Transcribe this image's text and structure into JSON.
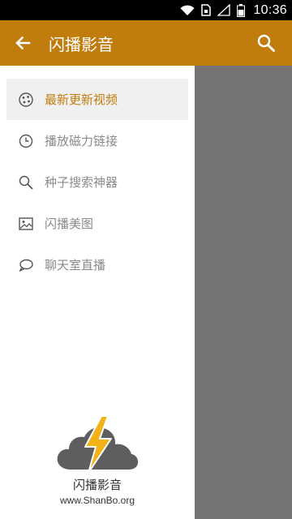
{
  "status_bar": {
    "time": "10:36",
    "icons": [
      "wifi-icon",
      "sim-card-icon",
      "signal-icon",
      "battery-icon"
    ]
  },
  "app_bar": {
    "title": "闪播影音",
    "back_icon": "arrow-left-icon",
    "search_icon": "search-icon",
    "color": "#c07d0e"
  },
  "drawer": {
    "items": [
      {
        "label": "最新更新视频",
        "icon": "film-reel-icon",
        "active": true
      },
      {
        "label": "播放磁力链接",
        "icon": "clock-icon",
        "active": false
      },
      {
        "label": "种子搜索神器",
        "icon": "search-icon",
        "active": false
      },
      {
        "label": "闪播美图",
        "icon": "image-icon",
        "active": false
      },
      {
        "label": "聊天室直播",
        "icon": "chat-bubble-icon",
        "active": false
      }
    ],
    "active_color": "#c07d0e",
    "inactive_color": "#8a8a8a"
  },
  "brand": {
    "name": "闪播影音",
    "url": "www.ShanBo.org",
    "logo_icon": "cloud-lightning-logo"
  }
}
